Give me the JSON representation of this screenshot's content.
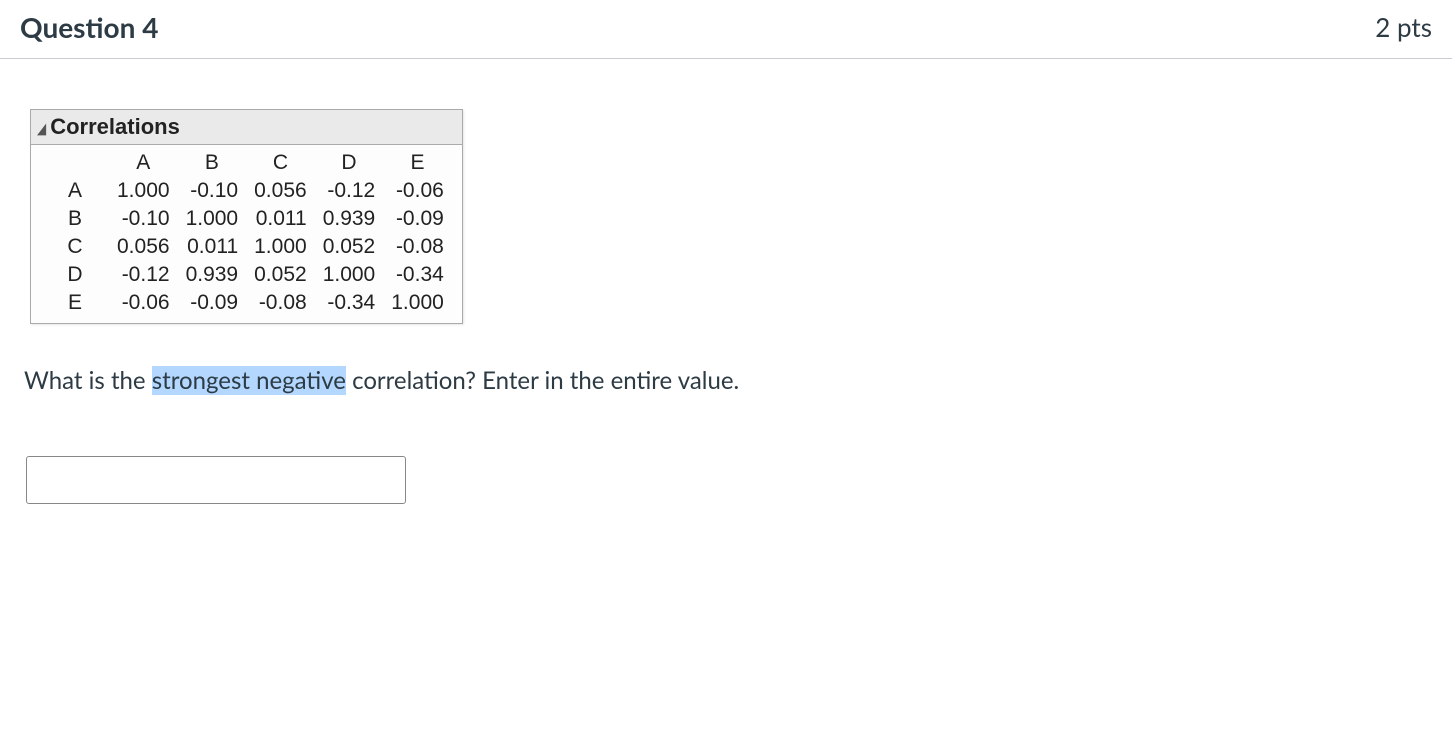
{
  "header": {
    "title": "Question 4",
    "points": "2 pts"
  },
  "panel": {
    "title": "Correlations"
  },
  "table": {
    "cols": [
      "A",
      "B",
      "C",
      "D",
      "E"
    ],
    "rows": [
      "A",
      "B",
      "C",
      "D",
      "E"
    ],
    "cells": {
      "r0c0": "1.000",
      "r0c1": "-0.10",
      "r0c2": "0.056",
      "r0c3": "-0.12",
      "r0c4": "-0.06",
      "r1c0": "-0.10",
      "r1c1": "1.000",
      "r1c2": "0.011",
      "r1c3": "0.939",
      "r1c4": "-0.09",
      "r2c0": "0.056",
      "r2c1": "0.011",
      "r2c2": "1.000",
      "r2c3": "0.052",
      "r2c4": "-0.08",
      "r3c0": "-0.12",
      "r3c1": "0.939",
      "r3c2": "0.052",
      "r3c3": "1.000",
      "r3c4": "-0.34",
      "r4c0": "-0.06",
      "r4c1": "-0.09",
      "r4c2": "-0.08",
      "r4c3": "-0.34",
      "r4c4": "1.000"
    }
  },
  "prompt": {
    "before": "What is the ",
    "highlight": "strongest negative",
    "after": " correlation? Enter in the entire value."
  },
  "chart_data": {
    "type": "table",
    "title": "Correlations",
    "categories": [
      "A",
      "B",
      "C",
      "D",
      "E"
    ],
    "matrix": [
      [
        1.0,
        -0.1,
        0.056,
        -0.12,
        -0.06
      ],
      [
        -0.1,
        1.0,
        0.011,
        0.939,
        -0.09
      ],
      [
        0.056,
        0.011,
        1.0,
        0.052,
        -0.08
      ],
      [
        -0.12,
        0.939,
        0.052,
        1.0,
        -0.34
      ],
      [
        -0.06,
        -0.09,
        -0.08,
        -0.34,
        1.0
      ]
    ]
  }
}
